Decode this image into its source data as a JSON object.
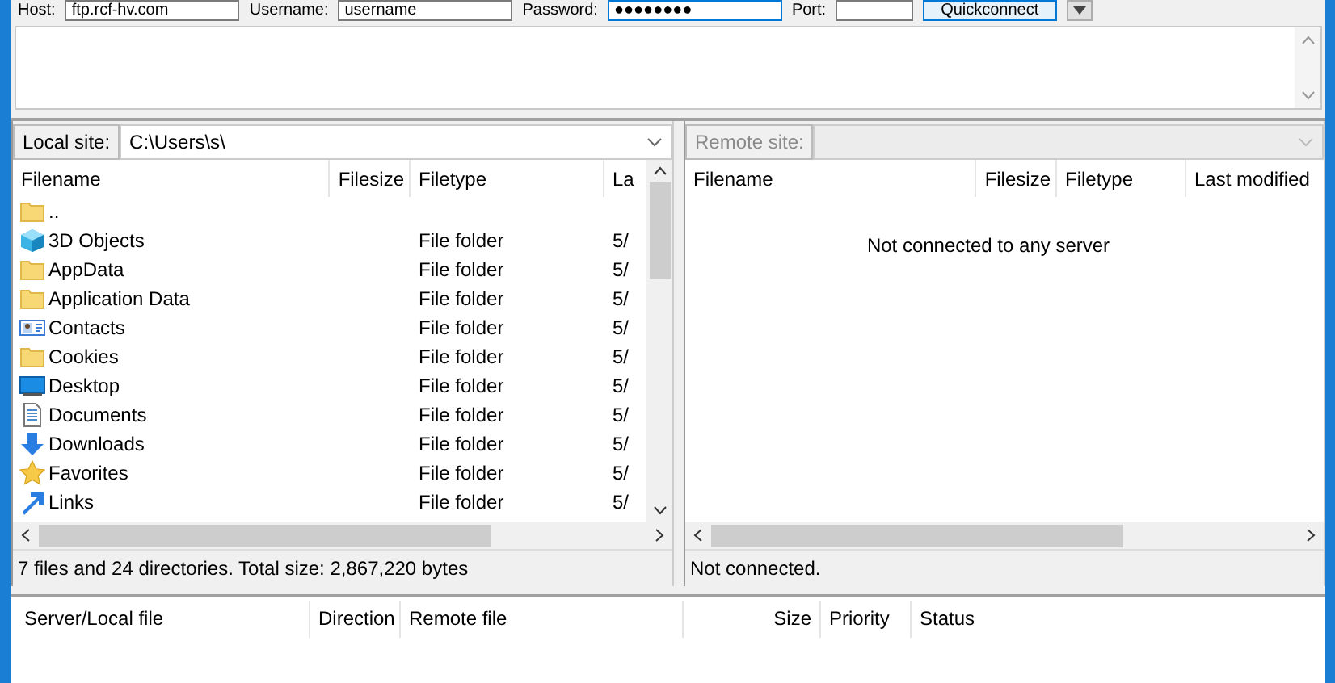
{
  "quickconnect": {
    "host_label": "Host:",
    "host": "ftp.rcf-hv.com",
    "username_label": "Username:",
    "username": "username",
    "password_label": "Password:",
    "password": "●●●●●●●●",
    "port_label": "Port:",
    "button": "Quickconnect"
  },
  "local": {
    "site_label": "Local site:",
    "path": "C:\\Users\\s\\",
    "columns": [
      "Filename",
      "Filesize",
      "Filetype",
      "La"
    ],
    "rows": [
      {
        "name": "..",
        "kind": "folder",
        "type": "",
        "modified": ""
      },
      {
        "name": "3D Objects",
        "kind": "cube",
        "type": "File folder",
        "modified": "5/"
      },
      {
        "name": "AppData",
        "kind": "folder",
        "type": "File folder",
        "modified": "5/"
      },
      {
        "name": "Application Data",
        "kind": "folder",
        "type": "File folder",
        "modified": "5/"
      },
      {
        "name": "Contacts",
        "kind": "contacts",
        "type": "File folder",
        "modified": "5/"
      },
      {
        "name": "Cookies",
        "kind": "folder",
        "type": "File folder",
        "modified": "5/"
      },
      {
        "name": "Desktop",
        "kind": "desktop",
        "type": "File folder",
        "modified": "5/"
      },
      {
        "name": "Documents",
        "kind": "documents",
        "type": "File folder",
        "modified": "5/"
      },
      {
        "name": "Downloads",
        "kind": "downloads",
        "type": "File folder",
        "modified": "5/"
      },
      {
        "name": "Favorites",
        "kind": "star",
        "type": "File folder",
        "modified": "5/"
      },
      {
        "name": "Links",
        "kind": "link",
        "type": "File folder",
        "modified": "5/"
      }
    ],
    "status": "7 files and 24 directories. Total size: 2,867,220 bytes"
  },
  "remote": {
    "site_label": "Remote site:",
    "columns": [
      "Filename",
      "Filesize",
      "Filetype",
      "Last modified"
    ],
    "empty_message": "Not connected to any server",
    "status": "Not connected."
  },
  "queue": {
    "columns": [
      "Server/Local file",
      "Direction",
      "Remote file",
      "Size",
      "Priority",
      "Status"
    ]
  }
}
